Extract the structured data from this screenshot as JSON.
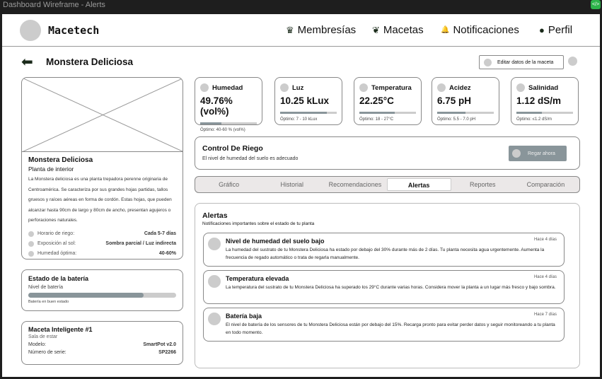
{
  "window": {
    "title": "Dashboard Wireframe - Alerts",
    "code_icon": "</>"
  },
  "header": {
    "brand": "Macetech",
    "nav": [
      {
        "icon": "crown-icon",
        "glyph": "♛",
        "label": "Membresías"
      },
      {
        "icon": "plant-icon",
        "glyph": "❦",
        "label": "Macetas"
      },
      {
        "icon": "bell-icon",
        "glyph": "🔔",
        "label": "Notificaciones"
      },
      {
        "icon": "user-icon",
        "glyph": "●",
        "label": "Perfil"
      }
    ]
  },
  "page": {
    "back_glyph": "⬅",
    "title": "Monstera Deliciosa",
    "edit_button": "Editar datos de la maceta"
  },
  "plant": {
    "name": "Monstera Deliciosa",
    "type": "Planta de interior",
    "description": "La Monstera deliciosa es una planta trepadora perenne originaria de Centroamérica. Se caracteriza por sus grandes hojas partidas, tallos gruesos y raíces aéreas en forma de cordón. Estas hojas, que pueden alcanzar hasta 90cm de largo y 80cm de ancho, presentan agujeros o perforaciones naturales.",
    "care": [
      {
        "label": "Horario de riego:",
        "value": "Cada 5-7 días"
      },
      {
        "label": "Exposición al sol:",
        "value": "Sombra parcial / Luz indirecta"
      },
      {
        "label": "Humedad óptima:",
        "value": "40-60%"
      }
    ]
  },
  "battery": {
    "title": "Estado de la batería",
    "label": "Nivel de batería",
    "level": 0.78,
    "status": "Batería en buen estado"
  },
  "pot": {
    "name": "Maceta Inteligente #1",
    "location": "Sala de estar",
    "rows": [
      {
        "label": "Modelo:",
        "value": "SmartPot v2.0"
      },
      {
        "label": "Número de serie:",
        "value": "SP2266"
      }
    ]
  },
  "metrics": [
    {
      "label": "Humedad",
      "value": "49.76% (vol%)",
      "optimal": "Óptimo: 40-60 % (vol%)",
      "fill": 0.38
    },
    {
      "label": "Luz",
      "value": "10.25 kLux",
      "optimal": "Óptimo: 7 - 10 kLux",
      "fill": 0.83
    },
    {
      "label": "Temperatura",
      "value": "22.25°C",
      "optimal": "Óptimo: 18 - 27°C",
      "fill": 0.62
    },
    {
      "label": "Acidez",
      "value": "6.75 pH",
      "optimal": "Óptimo: 5.5 - 7.0 pH",
      "fill": 0.5
    },
    {
      "label": "Salinidad",
      "value": "1.12 dS/m",
      "optimal": "Óptimo: ≤1.2 dS/m",
      "fill": 0.45
    }
  ],
  "irrigation": {
    "title": "Control De Riego",
    "status": "El nivel de humedad del suelo es adecuado",
    "button": "Regar ahora"
  },
  "tabs": [
    {
      "label": "Gráfico"
    },
    {
      "label": "Historial"
    },
    {
      "label": "Recomendaciones"
    },
    {
      "label": "Alertas",
      "active": true
    },
    {
      "label": "Reportes"
    },
    {
      "label": "Comparación"
    }
  ],
  "alerts": {
    "title": "Alertas",
    "subtitle": "Notificaciones importantes sobre el estado de tu planta",
    "items": [
      {
        "title": "Nivel de humedad del suelo bajo",
        "time": "Hace 4 días",
        "text": "La humedad del sustrato de tu Monstera Deliciosa ha estado por debajo del 30% durante más de 2 días. Tu planta necesita agua urgentemente. Aumenta la frecuencia de regado automático o trata de regarla manualmente."
      },
      {
        "title": "Temperatura elevada",
        "time": "Hace 4 días",
        "text": "La temperatura del sustrato de tu Monstera Deliciosa ha superado los 29°C durante varias horas. Considera mover la planta a un lugar más fresco y bajo sombra."
      },
      {
        "title": "Batería baja",
        "time": "Hace 7 días",
        "text": "El nivel de batería de los sensores de tu Monstera Deliciosa están por debajo del 15%. Recarga pronto para evitar perder datos y seguir monitoreando a tu planta en todo momento."
      }
    ]
  }
}
